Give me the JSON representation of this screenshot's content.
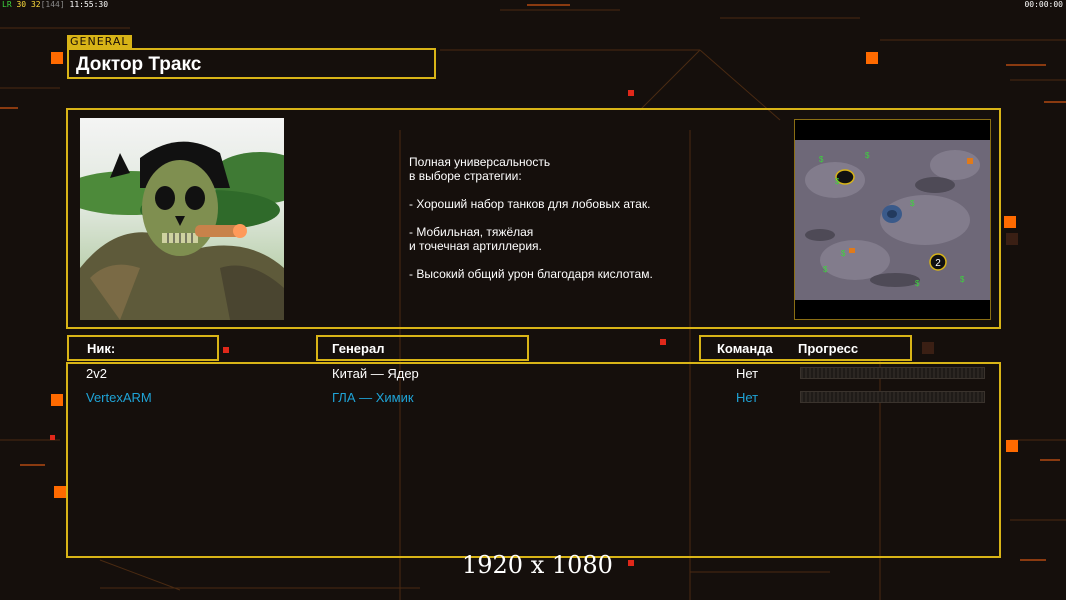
{
  "hud": {
    "stats_prefix": "LR",
    "stat_1": "30",
    "stat_2": "32",
    "stat_3": "[144]",
    "clock": "11:55:30",
    "timer": "00:00:00"
  },
  "header": {
    "tag": "GENERAL",
    "general_name": "Доктор Тракс"
  },
  "description": "Полная универсальность\nв выборе стратегии:\n\n- Хороший набор танков для лобовых атак.\n\n- Мобильная, тяжёлая\nи точечная артиллерия.\n\n- Высокий общий урон благодаря кислотам.",
  "columns": {
    "nick": "Ник:",
    "general": "Генерал",
    "team": "Команда",
    "progress": "Прогресс"
  },
  "players": [
    {
      "nick": "2v2",
      "general": "Китай — Ядер",
      "team": "Нет",
      "color": "#ffffff",
      "progress": 0
    },
    {
      "nick": "VertexARM",
      "general": "ГЛА — Химик",
      "team": "Нет",
      "color": "#1fa3d6",
      "progress": 0
    }
  ],
  "minimap": {
    "start_marker_label": "2"
  },
  "resolution_label": "1920 x 1080",
  "colors": {
    "frame": "#d8b417",
    "accent_orange": "#ff6a00",
    "accent_red": "#e0281a"
  }
}
